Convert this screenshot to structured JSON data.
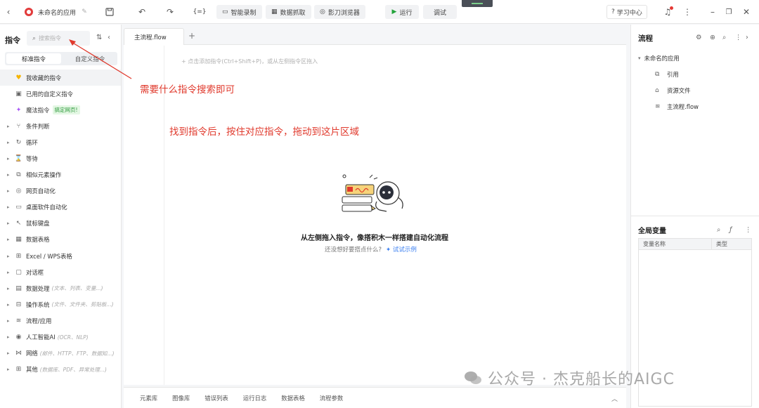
{
  "topbar": {
    "app_title": "未命名的应用",
    "record_label": "智能录制",
    "grab_label": "数据抓取",
    "browser_label": "影刀浏览器",
    "run_label": "运行",
    "debug_label": "调试",
    "learn_label": "学习中心",
    "code_icon_text": "{=}"
  },
  "left": {
    "title": "指令",
    "search_placeholder": "搜索指令",
    "tabs": [
      "标准指令",
      "自定义指令"
    ],
    "items": [
      {
        "label": "我收藏的指令",
        "icon": "heart-icon",
        "glyph": "♥"
      },
      {
        "label": "已用的自定义指令",
        "icon": "briefcase-icon",
        "glyph": "▣"
      },
      {
        "label": "魔法指令",
        "icon": "sparkle-icon",
        "glyph": "✦",
        "badge": "搞定网页!"
      },
      {
        "label": "条件判断",
        "icon": "branch-icon",
        "glyph": "⑂"
      },
      {
        "label": "循环",
        "icon": "loop-icon",
        "glyph": "↻"
      },
      {
        "label": "等待",
        "icon": "hourglass-icon",
        "glyph": "⌛"
      },
      {
        "label": "相似元素操作",
        "icon": "copy-icon",
        "glyph": "⧉"
      },
      {
        "label": "网页自动化",
        "icon": "globe-icon",
        "glyph": "◎"
      },
      {
        "label": "桌面软件自动化",
        "icon": "monitor-icon",
        "glyph": "▭"
      },
      {
        "label": "鼠标键盘",
        "icon": "cursor-icon",
        "glyph": "↖"
      },
      {
        "label": "数据表格",
        "icon": "table-icon",
        "glyph": "▦"
      },
      {
        "label": "Excel / WPS表格",
        "icon": "excel-icon",
        "glyph": "⊞"
      },
      {
        "label": "对话框",
        "icon": "dialog-icon",
        "glyph": "▢"
      },
      {
        "label": "数据处理",
        "icon": "data-icon",
        "glyph": "▤",
        "hint": "(文本、列表、变量...)"
      },
      {
        "label": "操作系统",
        "icon": "system-icon",
        "glyph": "⊟",
        "hint": "(文件、文件夹、剪贴板...)"
      },
      {
        "label": "流程/应用",
        "icon": "layers-icon",
        "glyph": "≋"
      },
      {
        "label": "人工智能AI",
        "icon": "ai-icon",
        "glyph": "◉",
        "hint": "(OCR、NLP)"
      },
      {
        "label": "网络",
        "icon": "network-icon",
        "glyph": "⋈",
        "hint": "(邮件、HTTP、FTP、数据知...)"
      },
      {
        "label": "其他",
        "icon": "grid-icon",
        "glyph": "⊞",
        "hint": "(数据库、PDF、异常处理...)"
      }
    ]
  },
  "editor": {
    "tab_label": "主流程.flow",
    "add_hint": "+ 点击添加指令(Ctrl+Shift+P)，或从左侧指令区拖入",
    "empty_title": "从左侧拖入指令，像搭积木一样搭建自动化流程",
    "empty_sub": "还没想好要搭点什么?",
    "empty_link": "✦ 试试示例"
  },
  "annotations": {
    "search_note": "需要什么指令搜索即可",
    "drag_note": "找到指令后，按住对应指令，拖动到这片区域"
  },
  "bottombar": {
    "items": [
      "元素库",
      "图像库",
      "错误列表",
      "运行日志",
      "数据表格",
      "流程参数"
    ]
  },
  "right": {
    "title": "流程",
    "app_node": "未命名的应用",
    "children": [
      {
        "label": "引用",
        "icon": "link-icon",
        "glyph": "⧉"
      },
      {
        "label": "资源文件",
        "icon": "folder-icon",
        "glyph": "⌂"
      },
      {
        "label": "主流程.flow",
        "icon": "layers-icon",
        "glyph": "≋"
      }
    ],
    "vars_title": "全局变量",
    "vars_columns": [
      "变量名称",
      "类型"
    ]
  },
  "watermark": "公众号 · 杰克船长的AIGC",
  "colors": {
    "accent": "#e0392c",
    "link": "#3b7ff0",
    "run_green": "#22a33a",
    "bulb_red": "#e53935"
  }
}
